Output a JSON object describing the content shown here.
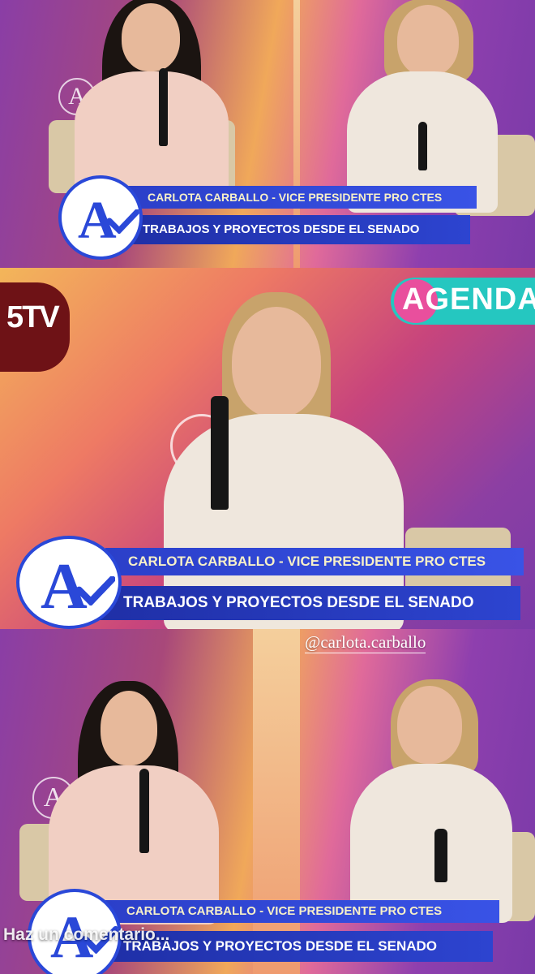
{
  "lower_third": {
    "name_line": "CARLOTA CARBALLO - VICE PRESIDENTE PRO CTES",
    "topic_line": "TRABAJOS Y PROYECTOS DESDE EL SENADO",
    "logo_letter": "A"
  },
  "watermark": {
    "letter": "A"
  },
  "channel_badge": {
    "label": "5TV"
  },
  "program_badge": {
    "label": "AGENDA"
  },
  "mention_sticker": {
    "label": "@carlota.carballo"
  },
  "comment_bar": {
    "placeholder": "Haz un comentario..."
  },
  "colors": {
    "lower_third_blue": "#2b3fc9",
    "lower_third_text": "#f7f0c8",
    "program_badge_teal": "#25c7c0",
    "program_badge_pink": "#e94f9d",
    "channel_badge_red": "#6e1216"
  }
}
